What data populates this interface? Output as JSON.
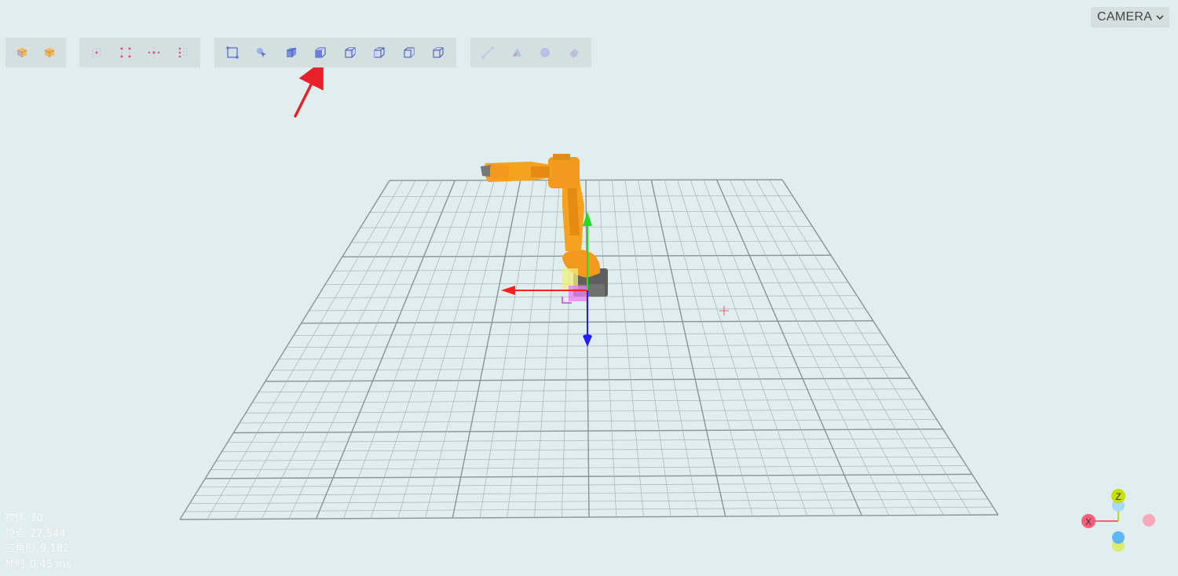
{
  "camera": {
    "label": "CAMERA",
    "icon": "chevron-down-icon"
  },
  "toolbar": {
    "groups": [
      {
        "name": "object-tools",
        "buttons": [
          {
            "icon": "object-cube-icon"
          },
          {
            "icon": "object-cube-alt-icon"
          }
        ]
      },
      {
        "name": "point-tools",
        "buttons": [
          {
            "icon": "point-center-icon"
          },
          {
            "icon": "point-corners-icon"
          },
          {
            "icon": "point-move-icon"
          },
          {
            "icon": "point-grid-icon"
          }
        ]
      },
      {
        "name": "view-tools",
        "buttons": [
          {
            "icon": "select-box-icon"
          },
          {
            "icon": "select-pointer-icon"
          },
          {
            "icon": "view-cube-solid-icon"
          },
          {
            "icon": "view-front-icon",
            "highlighted": true
          },
          {
            "icon": "view-back-icon"
          },
          {
            "icon": "view-left-icon"
          },
          {
            "icon": "view-right-icon"
          },
          {
            "icon": "view-top-icon"
          }
        ]
      },
      {
        "name": "measure-tools",
        "buttons": [
          {
            "icon": "measure-line-icon"
          },
          {
            "icon": "measure-angle-icon"
          },
          {
            "icon": "measure-circle-icon"
          },
          {
            "icon": "measure-eraser-icon"
          }
        ]
      }
    ]
  },
  "stats": {
    "objects": {
      "label": "物体",
      "value": "30"
    },
    "vertices": {
      "label": "顶点",
      "value": "27,544"
    },
    "triangles": {
      "label": "三角形",
      "value": "9,182"
    },
    "frame_time": {
      "label": "帧时",
      "value": "0.45 ms"
    }
  },
  "axis_gizmo": {
    "x_label": "X",
    "z_label": "Z"
  },
  "colors": {
    "background": "#e0eeef",
    "toolbar": "#d4dfe0",
    "grid": "#8b9594",
    "robot": "#f39a1e",
    "axis_x": "#ff1f1f",
    "axis_y": "#22dd22",
    "axis_z": "#1f1fff",
    "annotation_arrow": "#e8202a"
  }
}
